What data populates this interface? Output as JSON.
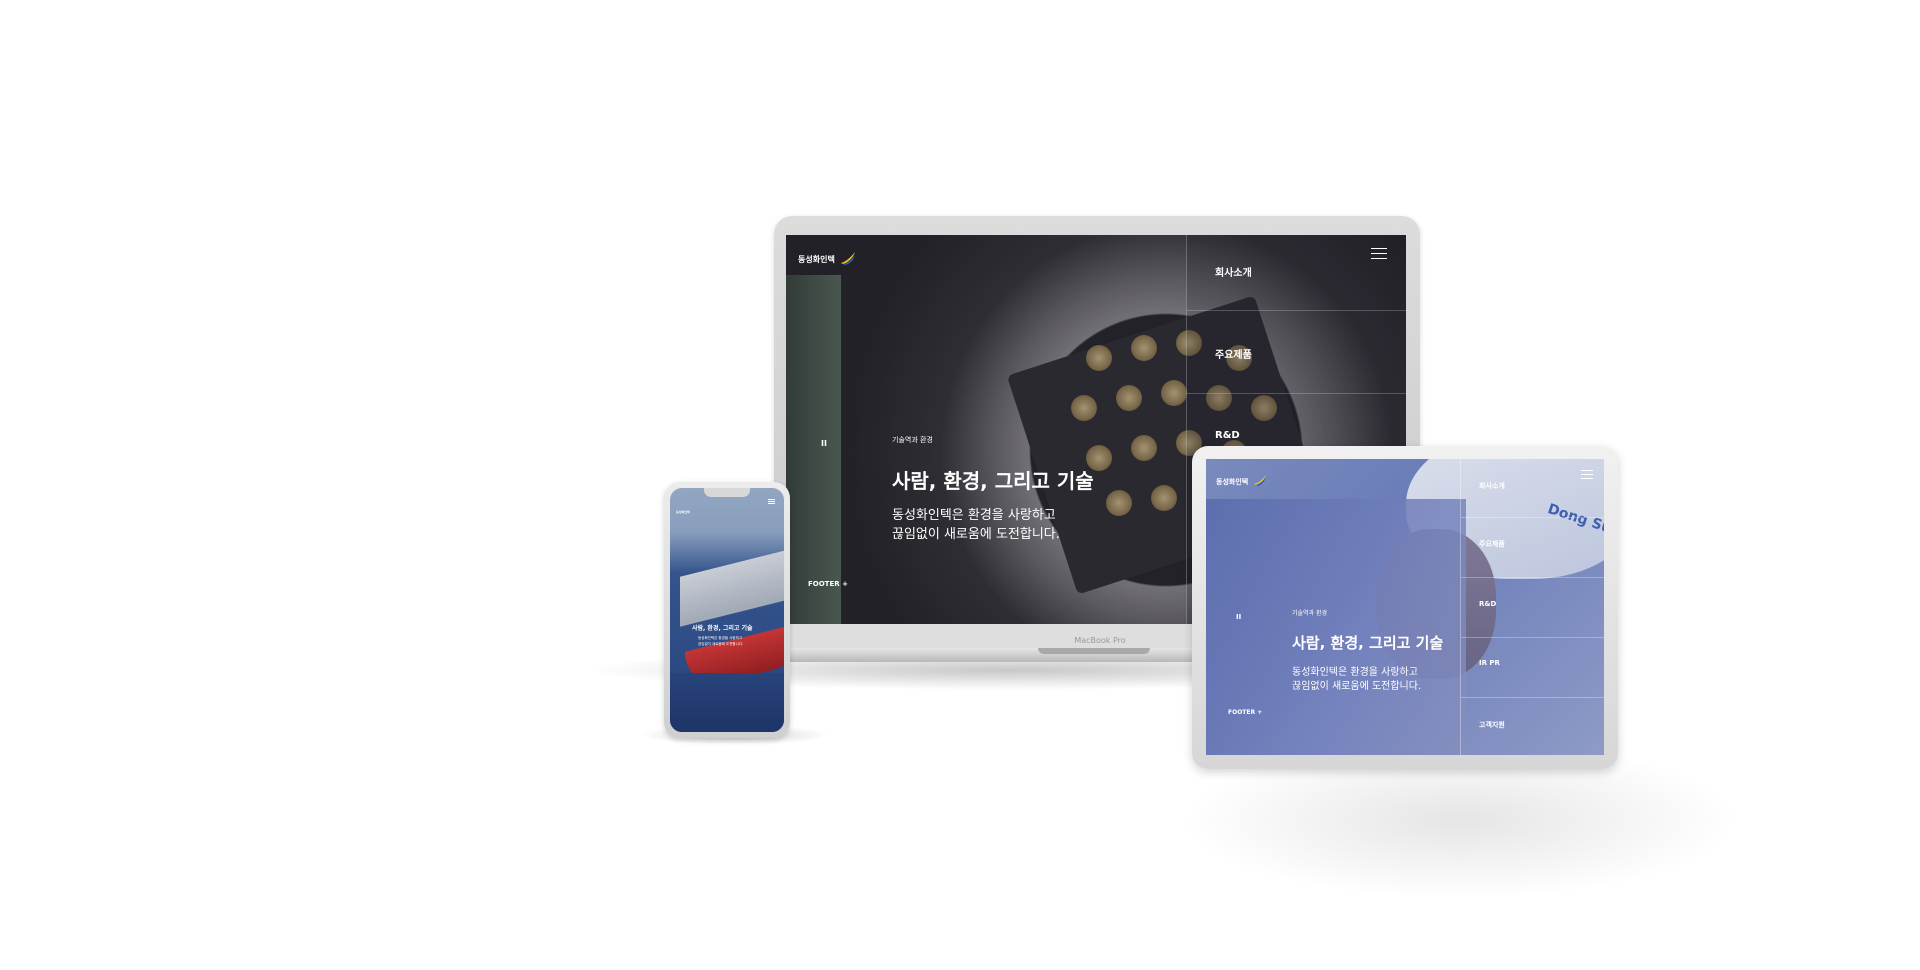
{
  "logo": {
    "text": "동성화인텍"
  },
  "menu": {
    "items": [
      "회사소개",
      "주요제품",
      "R&D",
      "IR PR",
      "고객지원"
    ]
  },
  "hero": {
    "eyebrow": "기술역과 환경",
    "title": "사람, 환경, 그리고 기술",
    "line1": "동성화인텍은 환경을 사랑하고",
    "line2": "끊임없이 새로움에 도전합니다."
  },
  "controls": {
    "pause": "II",
    "footer": "FOOTER +"
  },
  "laptop": {
    "brand": "MacBook Pro"
  },
  "tablet": {
    "helmet_text": "Dong Sung"
  },
  "phone": {
    "title": "사람, 환경, 그리고 기술",
    "line1": "동성화인텍은 환경을 사랑하고",
    "line2": "끊임없이 새로움에 도전합니다."
  }
}
